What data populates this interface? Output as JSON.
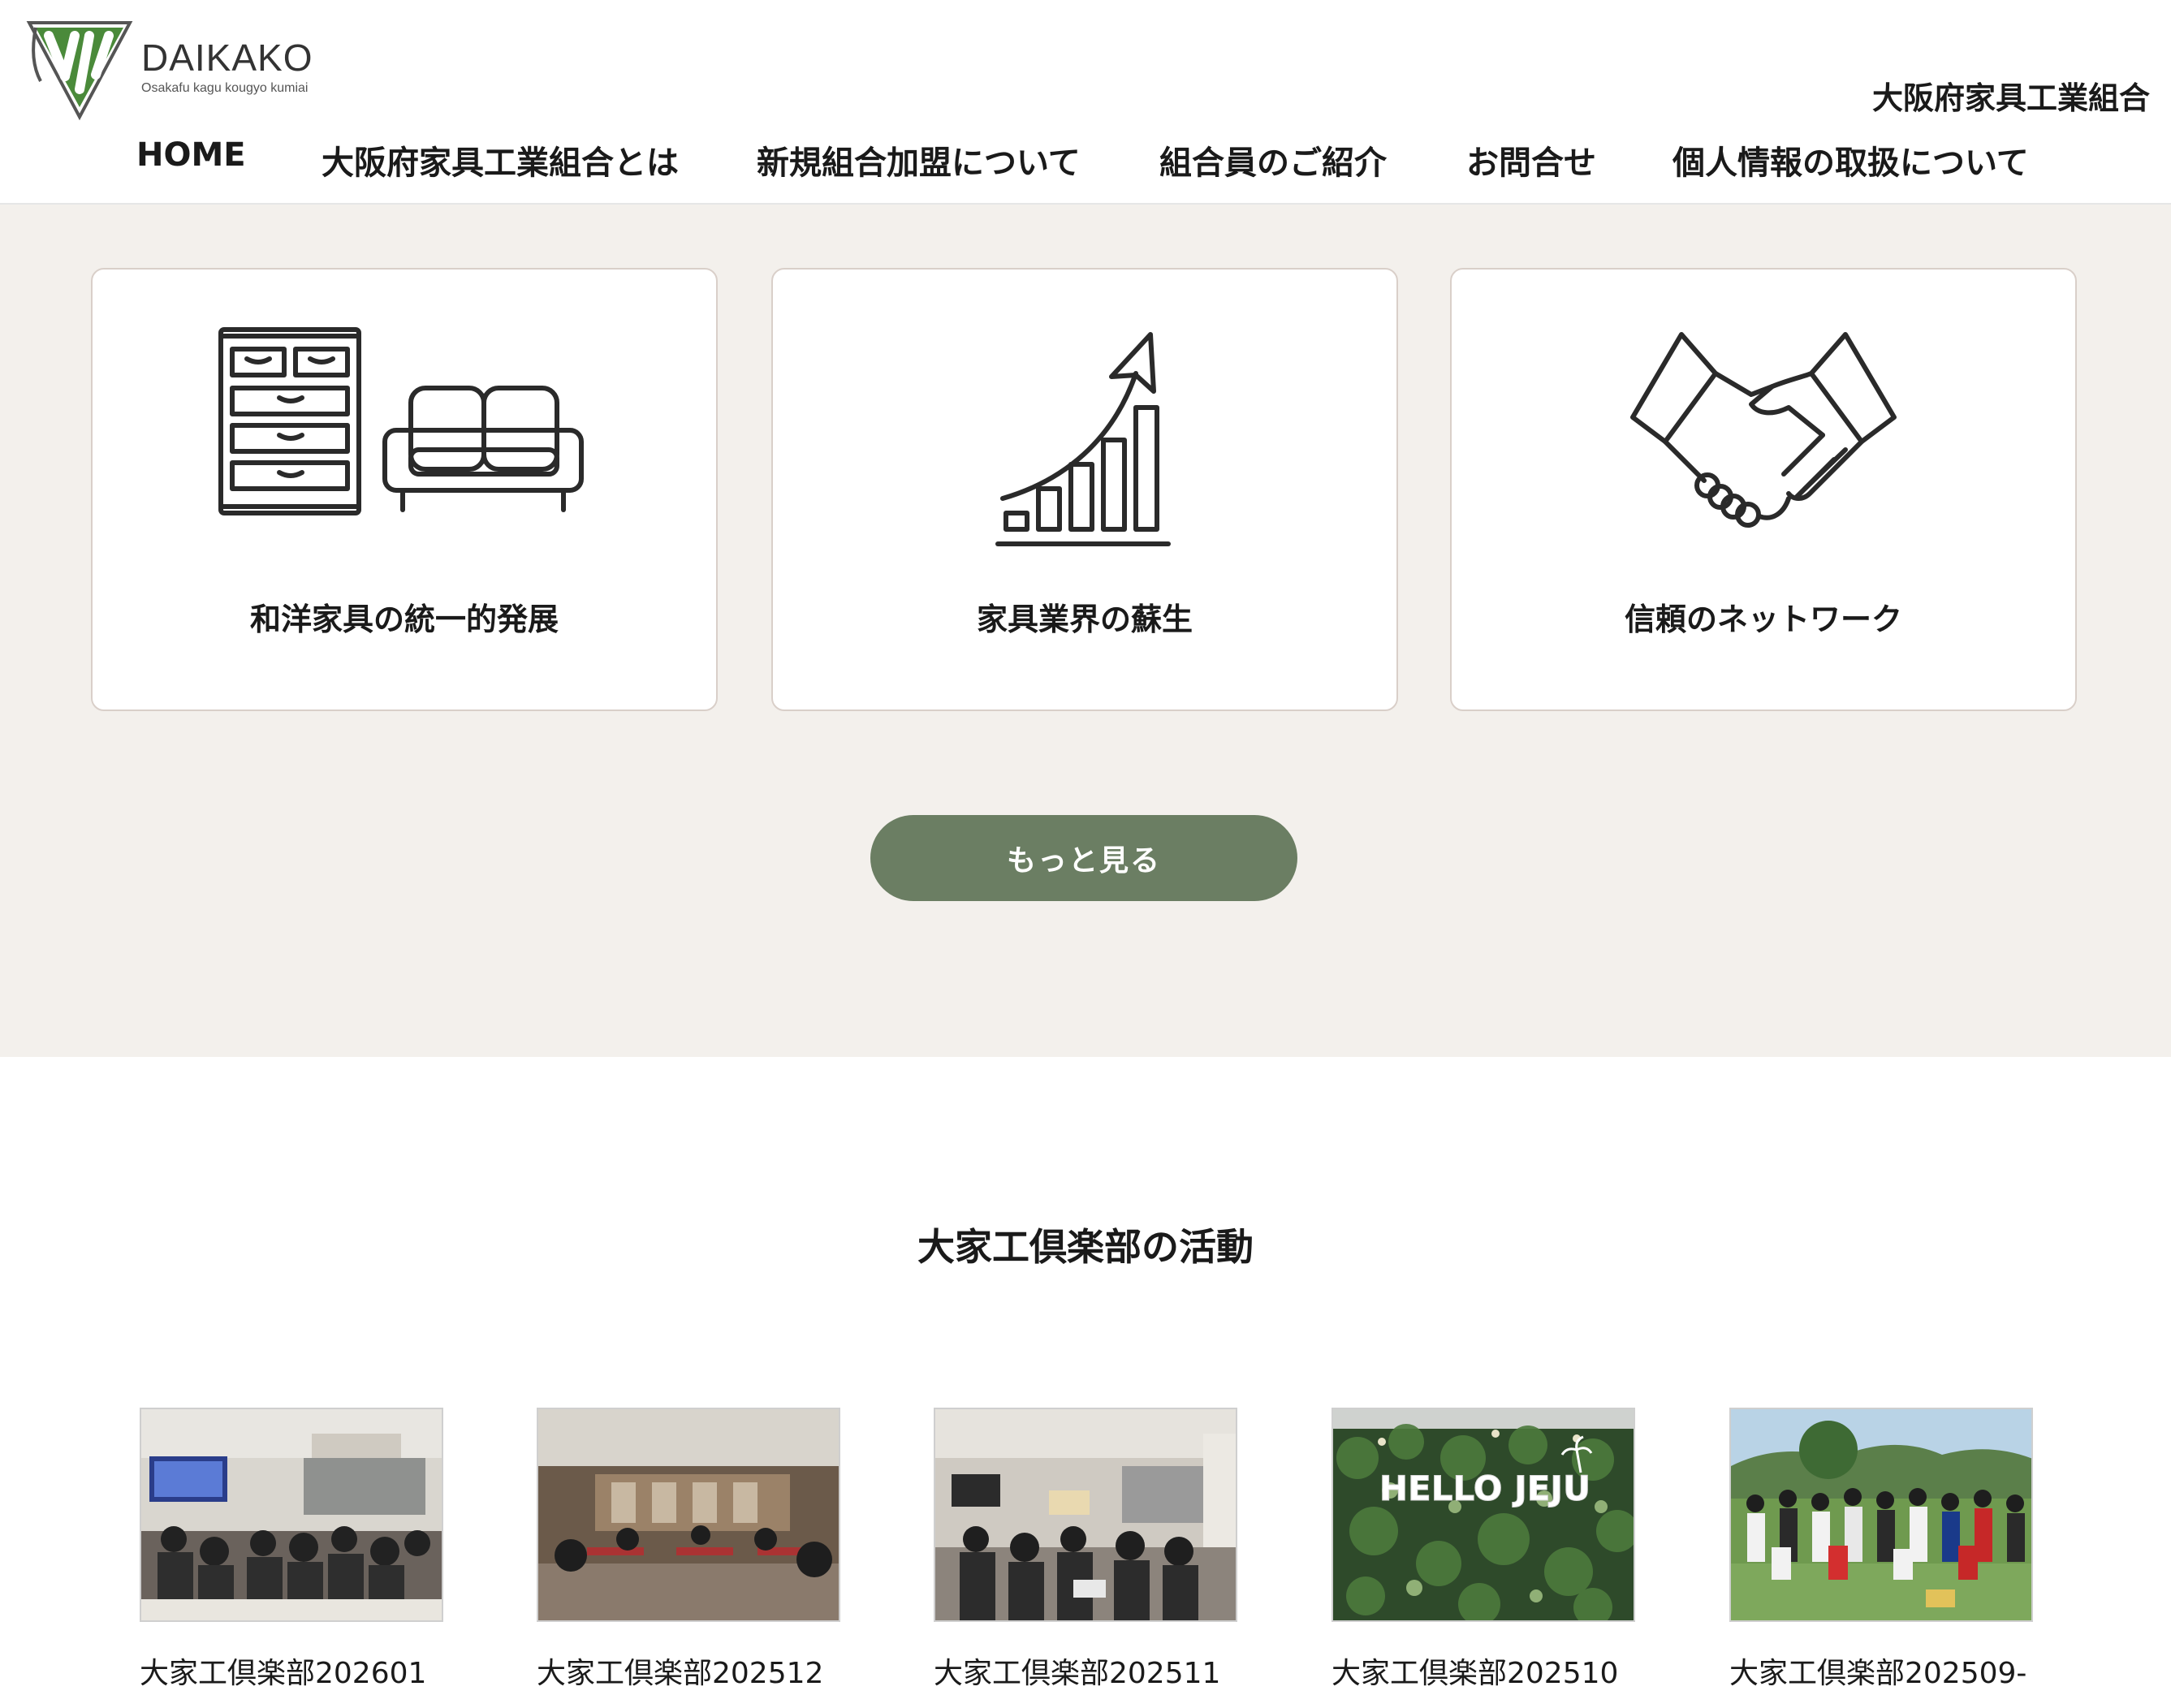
{
  "header": {
    "logo_name": "DAIKAKO",
    "logo_sub": "Osakafu kagu kougyo kumiai",
    "org_name": "大阪府家具工業組合"
  },
  "nav": {
    "items": [
      {
        "label": "HOME"
      },
      {
        "label": "大阪府家具工業組合とは"
      },
      {
        "label": "新規組合加盟について"
      },
      {
        "label": "組合員のご紹介"
      },
      {
        "label": "お問合せ"
      },
      {
        "label": "個人情報の取扱について"
      }
    ]
  },
  "features": {
    "cards": [
      {
        "label": "和洋家具の統一的発展",
        "icon": "furniture-icon"
      },
      {
        "label": "家具業界の蘇生",
        "icon": "growth-chart-icon"
      },
      {
        "label": "信頼のネットワーク",
        "icon": "handshake-icon"
      }
    ],
    "more_label": "もっと見る"
  },
  "activity": {
    "title": "大家工倶楽部の活動",
    "items": [
      {
        "label": "大家工倶楽部202601"
      },
      {
        "label": "大家工倶楽部202512"
      },
      {
        "label": "大家工倶楽部202511"
      },
      {
        "label": "大家工倶楽部202510",
        "photo_text": "HELLO JEJU"
      },
      {
        "label": "大家工倶楽部202509-"
      }
    ]
  },
  "colors": {
    "accent_green": "#6b7e63",
    "section_bg": "#f3f0ec",
    "logo_green": "#4a8a3a"
  }
}
